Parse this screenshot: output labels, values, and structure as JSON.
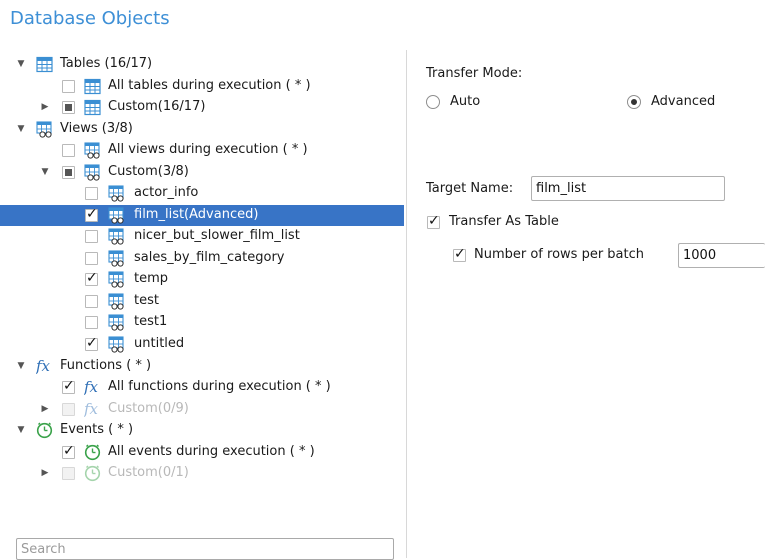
{
  "header": {
    "title": "Database Objects"
  },
  "tree": [
    {
      "label": "Tables (16/17)",
      "icon": "table-icon"
    },
    {
      "label": "All tables during execution ( * )",
      "icon": "table-icon"
    },
    {
      "label": "Custom(16/17)"
    },
    {
      "label": "Views (3/8)",
      "icon": "view-icon"
    },
    {
      "label": "All views during execution ( * )",
      "icon": "view-icon"
    },
    {
      "label": "Custom(3/8)",
      "icon": "view-icon"
    },
    {
      "label": "actor_info",
      "icon": "view-icon"
    },
    {
      "label": "film_list(Advanced)",
      "icon": "view-icon"
    },
    {
      "label": "nicer_but_slower_film_list",
      "icon": "view-icon"
    },
    {
      "label": "sales_by_film_category",
      "icon": "view-icon"
    },
    {
      "label": "temp",
      "icon": "view-icon"
    },
    {
      "label": "test",
      "icon": "view-icon"
    },
    {
      "label": "test1",
      "icon": "view-icon"
    },
    {
      "label": "untitled",
      "icon": "view-icon"
    },
    {
      "label": "Functions ( * )",
      "icon": "function-icon"
    },
    {
      "label": "All functions during execution ( * )",
      "icon": "function-icon"
    },
    {
      "label": "Custom(0/9)",
      "icon": "function-icon"
    },
    {
      "label": "Events ( * )",
      "icon": "event-clock-icon"
    },
    {
      "label": "All events during execution ( * )",
      "icon": "event-clock-icon"
    },
    {
      "label": "Custom(0/1)",
      "icon": "event-clock-icon"
    }
  ],
  "search": {
    "placeholder": "Search"
  },
  "right": {
    "transfer_mode_label": "Transfer Mode:",
    "auto_label": "Auto",
    "advanced_label": "Advanced",
    "selected_mode": "Advanced",
    "target_name_label": "Target Name:",
    "target_name_value": "film_list",
    "transfer_as_table_label": "Transfer As Table",
    "transfer_as_table_checked": true,
    "rows_per_batch_label": "Number of rows per batch",
    "rows_per_batch_checked": true,
    "rows_per_batch_value": "1000"
  },
  "colors": {
    "title": "#3d8fd6",
    "selection": "#3874c6",
    "table_icon": "#3b8fd3",
    "function_icon": "#2f6fb6",
    "event_icon": "#3aa24a"
  }
}
